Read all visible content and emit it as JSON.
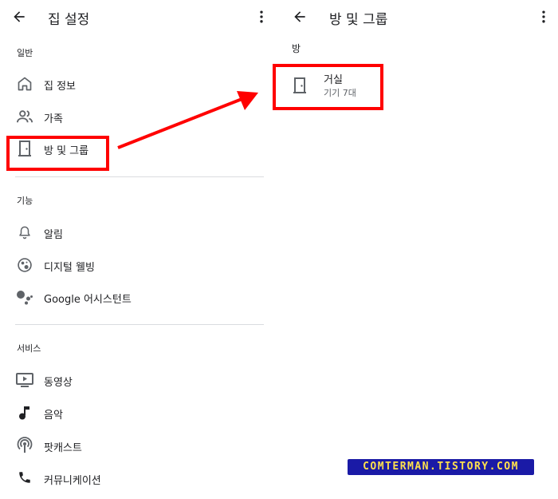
{
  "left_panel": {
    "title": "집 설정",
    "sections": [
      {
        "label": "일반",
        "items": [
          {
            "label": "집 정보",
            "icon": "home-icon"
          },
          {
            "label": "가족",
            "icon": "people-icon"
          },
          {
            "label": "방 및 그룹",
            "icon": "door-icon"
          }
        ]
      },
      {
        "label": "기능",
        "items": [
          {
            "label": "알림",
            "icon": "bell-icon"
          },
          {
            "label": "디지털 웰빙",
            "icon": "digital-wellbeing-icon"
          },
          {
            "label": "Google 어시스턴트",
            "icon": "google-assistant-icon"
          }
        ]
      },
      {
        "label": "서비스",
        "items": [
          {
            "label": "동영상",
            "icon": "video-icon"
          },
          {
            "label": "음악",
            "icon": "music-note-icon"
          },
          {
            "label": "팟캐스트",
            "icon": "podcast-icon"
          },
          {
            "label": "커뮤니케이션",
            "icon": "phone-icon"
          }
        ]
      }
    ]
  },
  "right_panel": {
    "title": "방 및 그룹",
    "section_label": "방",
    "rooms": [
      {
        "name": "거실",
        "device_count": "기기 7대",
        "icon": "door-icon"
      }
    ]
  },
  "watermark": "COMTERMAN.TISTORY.COM",
  "colors": {
    "highlight": "#ff0000",
    "arrow": "#ff0000",
    "icon": "#5f6368",
    "divider": "#dadce0",
    "watermark_bg": "#1a1aa6",
    "watermark_text": "#ffe14d"
  }
}
